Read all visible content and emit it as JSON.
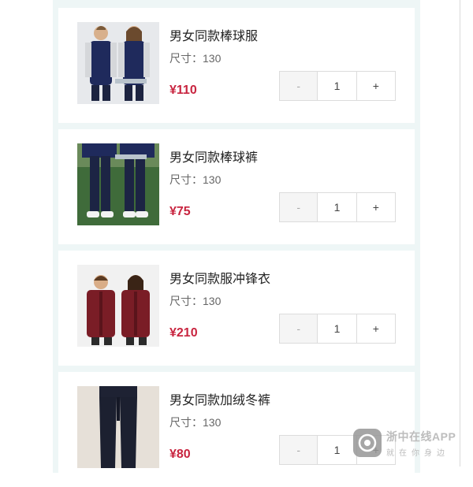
{
  "cart": {
    "items": [
      {
        "name": "男女同款棒球服",
        "size_label": "尺寸：130",
        "price": "¥110",
        "minus": "-",
        "qty": "1",
        "plus": "+"
      },
      {
        "name": "男女同款棒球裤",
        "size_label": "尺寸：130",
        "price": "¥75",
        "minus": "-",
        "qty": "1",
        "plus": "+"
      },
      {
        "name": "男女同款服冲锋衣",
        "size_label": "尺寸：130",
        "price": "¥210",
        "minus": "-",
        "qty": "1",
        "plus": "+"
      },
      {
        "name": "男女同款加绒冬裤",
        "size_label": "尺寸：130",
        "price": "¥80",
        "minus": "-",
        "qty": "1",
        "plus": "+"
      }
    ]
  },
  "watermark": {
    "title": "浙中在线APP",
    "subtitle": "就在你身边"
  },
  "colors": {
    "price": "#c8243f",
    "background": "#eef6f6"
  }
}
